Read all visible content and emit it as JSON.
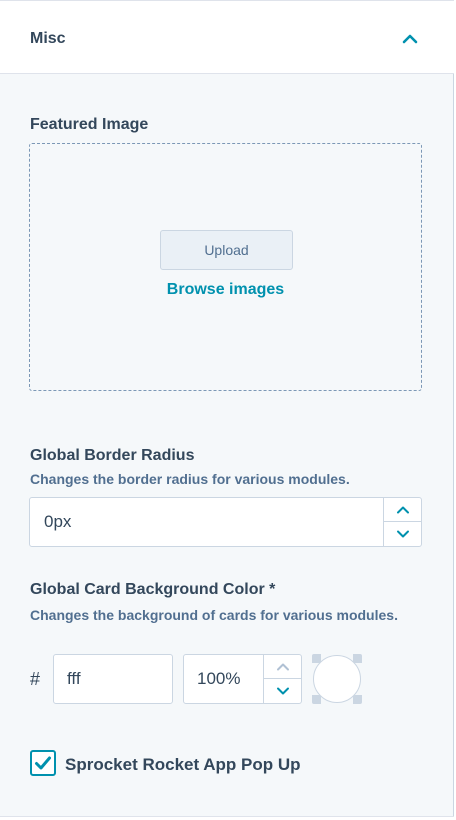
{
  "section": {
    "title": "Misc",
    "collapse_icon": "chevron-up-icon"
  },
  "featured_image": {
    "label": "Featured Image",
    "upload_label": "Upload",
    "browse_label": "Browse images"
  },
  "border_radius": {
    "label": "Global Border Radius",
    "help": "Changes the border radius for various modules.",
    "value": "0px",
    "increment_icon": "chevron-up-icon",
    "decrement_icon": "chevron-down-icon"
  },
  "card_background": {
    "label": "Global Card Background Color *",
    "help": "Changes the background of cards for various modules.",
    "hash": "#",
    "hex_value": "fff",
    "opacity_value": "100%",
    "swatch_color": "#ffffff"
  },
  "popup": {
    "label": "Sprocket Rocket App Pop Up",
    "checked": true,
    "check_icon": "checkmark-icon"
  },
  "colors": {
    "accent": "#0091ae",
    "text": "#33475b",
    "border": "#cbd6e2",
    "panel_bg": "#f5f8fa"
  }
}
